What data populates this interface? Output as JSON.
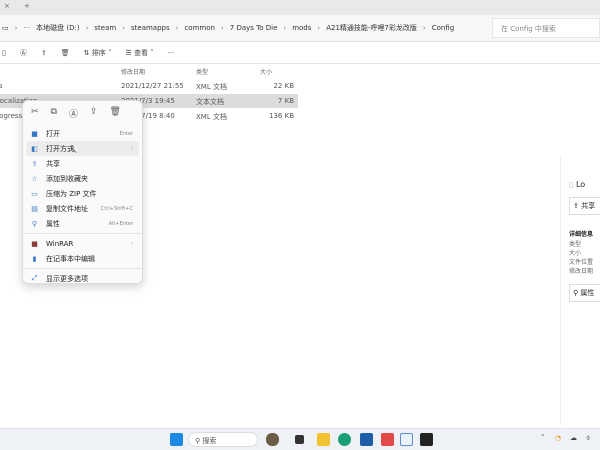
{
  "tabbar": {
    "close": "×",
    "new_tab": "+"
  },
  "address": {
    "crumbs": [
      "本地磁盘 (D:)",
      "steam",
      "steamapps",
      "common",
      "7 Days To Die",
      "mods",
      "A21精通技能-呼哩7彩龙改版",
      "Config"
    ],
    "search_placeholder": "在 Config 中搜索"
  },
  "toolbar": {
    "sort": "排序",
    "view": "查看",
    "more": "···"
  },
  "columns": {
    "date": "修改日期",
    "type": "类型",
    "size": "大小"
  },
  "files": [
    {
      "name": "ffs",
      "date": "2021/12/27 21:55",
      "type": "XML 文档",
      "size": "22 KB"
    },
    {
      "name": "Localization",
      "date": "2021/7/3 19:45",
      "type": "文本文档",
      "size": "7 KB"
    },
    {
      "name": "progression",
      "date": "2021/7/19 8:40",
      "type": "XML 文档",
      "size": "136 KB"
    }
  ],
  "menu": {
    "items": [
      {
        "label": "打开",
        "shortcut": "Enter",
        "icon": "open-icon"
      },
      {
        "label": "打开方式",
        "shortcut": "›",
        "icon": "open-with-icon"
      },
      {
        "label": "共享",
        "shortcut": "",
        "icon": "share-icon"
      },
      {
        "label": "添加到收藏夹",
        "shortcut": "",
        "icon": "star-icon"
      },
      {
        "label": "压缩为 ZIP 文件",
        "shortcut": "",
        "icon": "zip-icon"
      },
      {
        "label": "复制文件地址",
        "shortcut": "Ctrl+Shift+C",
        "icon": "copy-path-icon"
      },
      {
        "label": "属性",
        "shortcut": "Alt+Enter",
        "icon": "properties-icon"
      },
      {
        "label": "WinRAR",
        "shortcut": "›",
        "icon": "winrar-icon"
      },
      {
        "label": "在记事本中编辑",
        "shortcut": "",
        "icon": "notepad-icon"
      },
      {
        "label": "显示更多选项",
        "shortcut": "",
        "icon": "more-options-icon"
      }
    ]
  },
  "pane": {
    "filename": "Lo",
    "share": "共享",
    "details": "详细信息",
    "fields": [
      "类型",
      "大小",
      "文件位置",
      "修改日期"
    ],
    "properties": "属性"
  },
  "taskbar": {
    "search": "搜索"
  }
}
